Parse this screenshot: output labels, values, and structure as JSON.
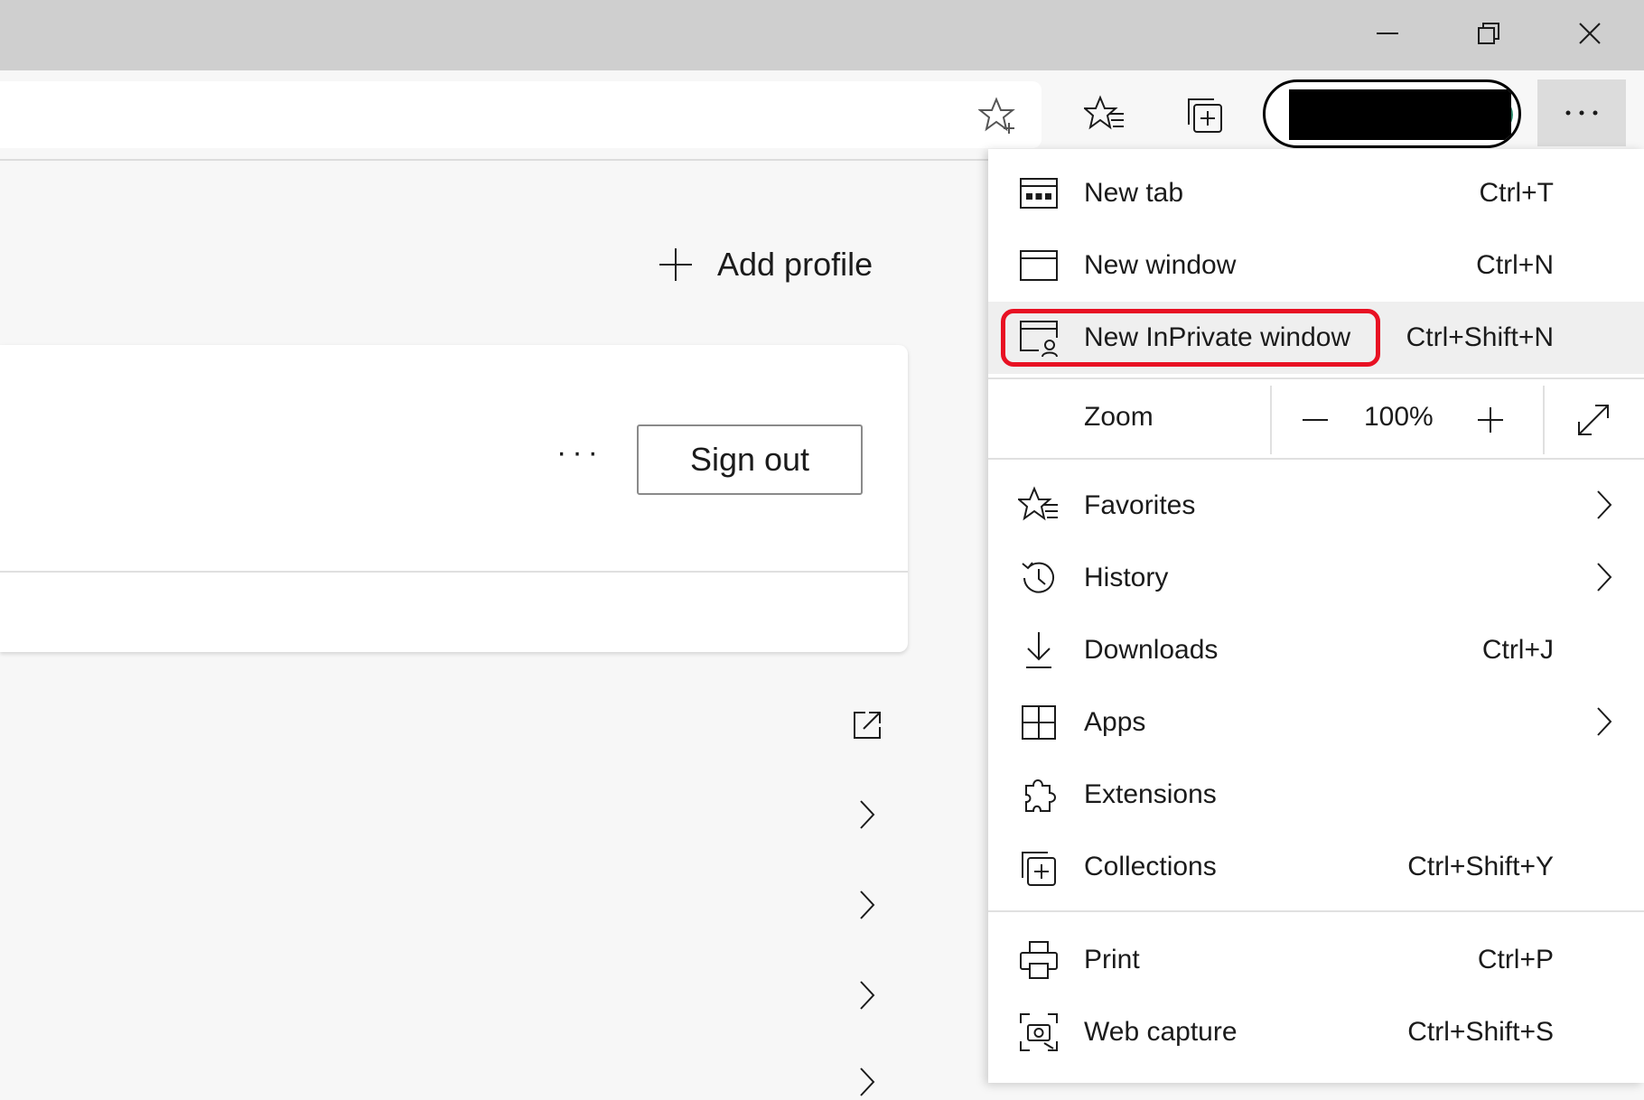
{
  "window": {
    "minimize_label": "minimize",
    "restore_label": "restore",
    "close_label": "close"
  },
  "page": {
    "add_profile_label": "Add profile",
    "sign_out_label": "Sign out",
    "more_label": "···"
  },
  "menu": {
    "items_top": [
      {
        "id": "new-tab",
        "label": "New tab",
        "shortcut": "Ctrl+T",
        "icon": "new-tab-icon"
      },
      {
        "id": "new-window",
        "label": "New window",
        "shortcut": "Ctrl+N",
        "icon": "new-window-icon"
      },
      {
        "id": "new-inprivate-window",
        "label": "New InPrivate window",
        "shortcut": "Ctrl+Shift+N",
        "icon": "inprivate-icon",
        "highlighted": true
      }
    ],
    "zoom": {
      "label": "Zoom",
      "value": "100%"
    },
    "items_mid": [
      {
        "id": "favorites",
        "label": "Favorites",
        "shortcut": "",
        "icon": "favorites-icon",
        "submenu": true
      },
      {
        "id": "history",
        "label": "History",
        "shortcut": "",
        "icon": "history-icon",
        "submenu": true
      },
      {
        "id": "downloads",
        "label": "Downloads",
        "shortcut": "Ctrl+J",
        "icon": "download-icon"
      },
      {
        "id": "apps",
        "label": "Apps",
        "shortcut": "",
        "icon": "apps-icon",
        "submenu": true
      },
      {
        "id": "extensions",
        "label": "Extensions",
        "shortcut": "",
        "icon": "extensions-icon"
      },
      {
        "id": "collections",
        "label": "Collections",
        "shortcut": "Ctrl+Shift+Y",
        "icon": "collections-icon"
      }
    ],
    "items_bottom": [
      {
        "id": "print",
        "label": "Print",
        "shortcut": "Ctrl+P",
        "icon": "print-icon"
      },
      {
        "id": "web-capture",
        "label": "Web capture",
        "shortcut": "Ctrl+Shift+S",
        "icon": "web-capture-icon"
      }
    ]
  },
  "colors": {
    "highlight_outline": "#e81123",
    "titlebar": "#cfcfcf",
    "menu_hover": "#efefef"
  }
}
